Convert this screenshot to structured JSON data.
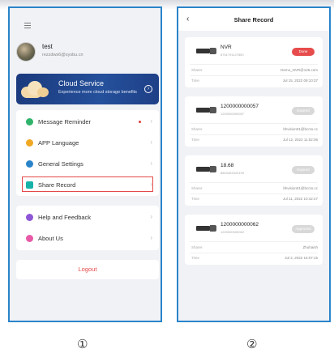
{
  "screen1": {
    "user": {
      "name": "test",
      "email": "rezzdws6@sysbu.cn"
    },
    "cloud": {
      "title": "Cloud Service",
      "subtitle": "Experience more cloud storage benefits"
    },
    "menu_primary": [
      {
        "label": "Message Reminder",
        "icon": "bell-icon",
        "color": "#2fb36a"
      },
      {
        "label": "APP Language",
        "icon": "globe-icon",
        "color": "#f0a823"
      },
      {
        "label": "General Settings",
        "icon": "gear-icon",
        "color": "#2a84c9"
      },
      {
        "label": "Share Record",
        "icon": "share-icon",
        "color": "#16b2a8"
      }
    ],
    "menu_secondary": [
      {
        "label": "Help and Feedback",
        "icon": "help-icon",
        "color": "#8e56d6"
      },
      {
        "label": "About Us",
        "icon": "info-icon",
        "color": "#e85aa8"
      }
    ],
    "logout": "Logout"
  },
  "screen2": {
    "title": "Share Record",
    "sharer_label": "Sharer",
    "time_label": "Time",
    "records": [
      {
        "name": "NVR",
        "sn": "8761791127850",
        "status": "Done",
        "sharer": "Demo_NVR@126.com",
        "time": "Jul 15, 2022 09:10:37"
      },
      {
        "name": "1200000000057",
        "sn": "1200000000057",
        "status": "Expired",
        "sharer": "bhvision01@bccto.cc",
        "time": "Jul 12, 2022 11:52:06"
      },
      {
        "name": "18.68",
        "sn": "8803463343199",
        "status": "Expired",
        "sharer": "bhvision01@bccto.cc",
        "time": "Jul 11, 2022 10:42:47"
      },
      {
        "name": "1200000000062",
        "sn": "1200000000062",
        "status": "Approved",
        "sharer": "Zhuhaish",
        "time": "Jul 2, 2022 16:07:15"
      }
    ]
  },
  "captions": [
    "①",
    "②"
  ],
  "colors": {
    "frame": "#2a84c9",
    "accent_red": "#e54848",
    "cloud_card": "#1e3f86"
  }
}
